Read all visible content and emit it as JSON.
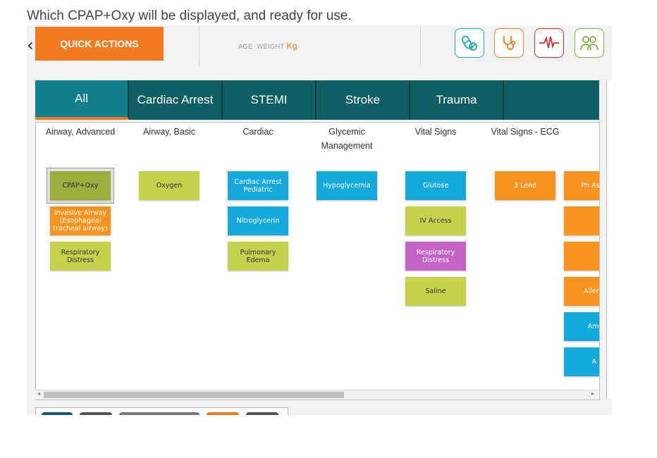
{
  "question": "Which CPAP+Oxy will be displayed, and ready for use.",
  "header": {
    "quick_actions_label": "QUICK ACTIONS",
    "age_label": "AGE",
    "weight_label": "WEIGHT",
    "weight_unit": "Kg",
    "icons": [
      {
        "name": "medication-icon",
        "color": "#1ab0a8"
      },
      {
        "name": "stethoscope-icon",
        "color": "#f47a20"
      },
      {
        "name": "ecg-icon",
        "color": "#d32f2f"
      },
      {
        "name": "patients-icon",
        "color": "#7cb342"
      }
    ]
  },
  "tabs": [
    "All",
    "Cardiac Arrest",
    "STEMI",
    "Stroke",
    "Trauma"
  ],
  "active_tab": "All",
  "columns": [
    {
      "header": "Airway, Advanced",
      "items": [
        {
          "label": "CPAP+Oxy",
          "color": "#9aae3e",
          "selected": true
        },
        {
          "label": "Invasive Airway (Esophageal tracheal airway)",
          "color": "#f7931e"
        },
        {
          "label": "Respiratory Distress",
          "color": "#c3d24a"
        }
      ]
    },
    {
      "header": "Airway, Basic",
      "items": [
        {
          "label": "Oxygen",
          "color": "#c3d24a"
        }
      ]
    },
    {
      "header": "Cardiac",
      "items": [
        {
          "label": "Cardiac Arrest Pediatric",
          "color": "#16a9dc"
        },
        {
          "label": "Nitroglycerin",
          "color": "#16a9dc"
        },
        {
          "label": "Pulmonary Edema",
          "color": "#c3d24a"
        }
      ]
    },
    {
      "header": "Glycemic Management",
      "items": [
        {
          "label": "Hypoglycemia",
          "color": "#16a9dc"
        }
      ]
    },
    {
      "header": "Vital Signs",
      "items": [
        {
          "label": "Glutose",
          "color": "#16a9dc"
        },
        {
          "label": "IV Access",
          "color": "#c3d24a"
        },
        {
          "label": "Respiratory Distress",
          "color": "#c664c6"
        },
        {
          "label": "Saline",
          "color": "#c3d24a"
        }
      ]
    },
    {
      "header": "Vital Signs - ECG",
      "items": [
        {
          "label": "3 Lead",
          "color": "#f7931e"
        }
      ]
    },
    {
      "header": "",
      "items": [
        {
          "label": "Ph Asse",
          "color": "#f7931e"
        },
        {
          "label": "",
          "color": "#f7931e"
        },
        {
          "label": "",
          "color": "#f7931e"
        },
        {
          "label": "Allergi",
          "color": "#f7931e"
        },
        {
          "label": "Ami",
          "color": "#16a9dc"
        },
        {
          "label": "A",
          "color": "#16a9dc"
        }
      ]
    }
  ],
  "bottom_pills": [
    {
      "color": "#0e5e66"
    },
    {
      "color": "#555555"
    },
    {
      "color": "#777777"
    },
    {
      "color": "#f47a20"
    },
    {
      "color": "#555555"
    }
  ]
}
